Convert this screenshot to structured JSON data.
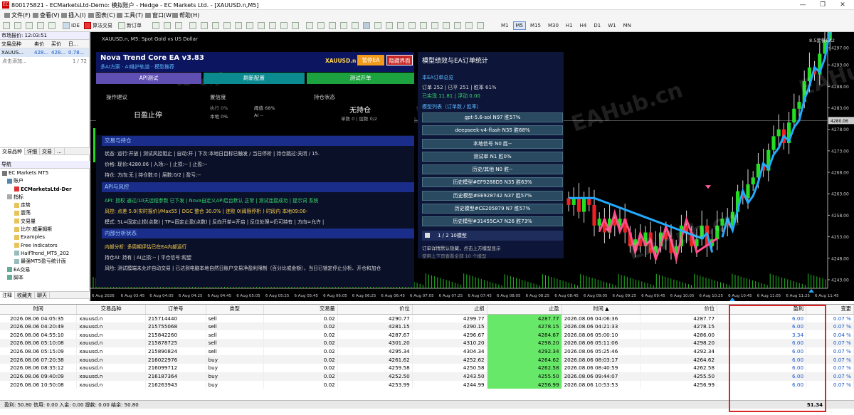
{
  "window": {
    "title": "800175821 - ECMarketsLtd-Demo: 模拟账户 - Hedge - EC Markets Ltd. - [XAUUSD.n,M5]",
    "controls": [
      "—",
      "❐",
      "✕"
    ],
    "icon_text": "EC"
  },
  "menu": [
    "文件(F)",
    "查看(V)",
    "插入(I)",
    "图表(C)",
    "工具(T)",
    "窗口(W)",
    "帮助(H)"
  ],
  "toolbar": {
    "ide": "IDE",
    "algo": "算法交易",
    "new_order": "新订单",
    "timeframes": [
      "M1",
      "M5",
      "M15",
      "M30",
      "H1",
      "H4",
      "D1",
      "W1",
      "MN"
    ],
    "active_tf": "M5"
  },
  "market_watch": {
    "header": "市场报价: 12:03:51",
    "columns": [
      "交易品种",
      "卖价",
      "买价",
      "日..."
    ],
    "rows": [
      {
        "symbol": "XAUUS...",
        "bid": "428...",
        "ask": "428...",
        "change": "0.78..."
      }
    ],
    "add": "点击添加...",
    "count": "1 / 72",
    "tabs": [
      "交易品种",
      "详细",
      "交易",
      "..."
    ]
  },
  "navigator": {
    "header": "导航",
    "items": [
      "EC Markets MT5",
      "账户",
      "ECMarketsLtd-Der",
      "指标",
      "走势",
      "震荡",
      "交易量",
      "比尔·威廉姆斯",
      "Examples",
      "Free Indicators",
      "HalfTrend_MT5_202",
      "最强MT5盈亏统计面",
      "EA交易",
      "脚本"
    ],
    "tabs": [
      "注释",
      "收藏夹",
      "聊天"
    ]
  },
  "chart": {
    "symbol_label": "XAUUSD.n, M5:  Spot Gold vs US Dollar",
    "top_right_label": "8.5套餐EA2",
    "price_ticks": [
      "4297.00",
      "4293.00",
      "4288.00",
      "4283.00",
      "4278.00",
      "4273.00",
      "4268.00",
      "4263.00",
      "4258.00",
      "4253.00",
      "4248.00",
      "4243.00"
    ],
    "current_price": "4280.06",
    "time_ticks": [
      "6 Aug 2026",
      "6 Aug 03:45",
      "6 Aug 04:05",
      "6 Aug 04:25",
      "6 Aug 04:45",
      "6 Aug 05:05",
      "6 Aug 05:25",
      "6 Aug 05:45",
      "6 Aug 06:05",
      "6 Aug 06:25",
      "6 Aug 06:45",
      "6 Aug 07:05",
      "6 Aug 07:25",
      "6 Aug 07:45",
      "6 Aug 08:05",
      "6 Aug 08:25",
      "6 Aug 08:45",
      "6 Aug 09:05",
      "6 Aug 09:25",
      "6 Aug 09:45",
      "6 Aug 10:05",
      "6 Aug 10:25",
      "6 Aug 10:45",
      "6 Aug 11:05",
      "6 Aug 11:25",
      "6 Aug 11:45"
    ],
    "watermark": "EAHub.cn"
  },
  "ea": {
    "title": "Nova Trend Core EA v3.83",
    "subtitle": "多AI方案 · AI维护轨道 · 模型推荐",
    "symbol": "XAUUSD.n  M5",
    "btn_pause": "暂停EA",
    "btn_hide": "隐藏界面",
    "btn_api": "API测试",
    "btn_refresh": "刷新配置",
    "btn_test_open": "测试开单",
    "advice_label": "操作建议",
    "advice_value": "日盈止停",
    "confidence_label": "置信度",
    "conf_exec": "执行 0%",
    "conf_thresh": "阈值 68%",
    "conf_local": "本地 0%",
    "conf_ai": "AI --",
    "position_label": "持仓状态",
    "position_value": "无持仓",
    "position_detail": "单数 0 | 层数 0/2",
    "sec_trade": "交易与持仓",
    "trade_line1": "状态: 运行:开放 | 测试风控阻止 | 自动:开 | 下次:本地日目标已触发 / 当日停析 | 持仓跳过:关闭 / 15.",
    "trade_line2": "价格: 现价:4280.06 | 入场:-- | 止损:-- | 止盈:--",
    "trade_line3": "持仓: 方向:无 | 持仓数:0 | 层数:0/2 | 盈亏:--",
    "sec_api": "API与风控",
    "api_line1": "API: 授权 通过/10天远程参数 已下发 | Nova自定义API后台默认 正常 | 测试连接成功 | 提示词 系统",
    "api_line2": "风控: 点差 5.0(实时报价)/Max55 | DGC 整合 30.0% | 连败 0(阈限停析 ) 时段内 本地09:00-",
    "api_line3": "模式: SL=固定止损(点数) | TP=固定止盈(点数) | 反向开单=开启 | 反位处理=仍可持有 | 方向=允许 |",
    "sec_internal": "内部分析状态",
    "int_line1": "内部分析: 多周期评估已在EA内部运行",
    "int_line2": "持仓AI: 持有 | AI止损:-- | 平仓信号:观望",
    "int_line3": "风险: 测试模端未允许自动交易 | 已达到电脑本地自然日账户交易净盈利限制（百分比或金额），当日已锁定停止分析、开仓和加仓"
  },
  "stats": {
    "title": "模型绩效与EA订单统计",
    "sec_orders": "本EA订单总览",
    "orders_line": "订单 252 | 已平 251 | 胜率 61%",
    "realized": "已实现 11.81 | 浮动 0.00",
    "sec_models": "模型列表（订单数 / 胜率）",
    "models": [
      "gpt-5.6-sol  N97  胜57%",
      "deepseek-v4-flash  N35  胜68%",
      "本地信号  N0  胜--",
      "测试单  N1  胜0%",
      "历史/其他  N0  胜--",
      "历史模型#EF9288D5  N35  胜63%",
      "历史模型#EE928742  N37  胜57%",
      "历史模型#CE205879  N7  胜57%",
      "历史模型#31455CA7  N26  胜73%"
    ],
    "pager": "1 / 2   10模型",
    "hint1": "订单详情默认隐藏，点击上方模型显示",
    "hint2": "使用上下页查看全部 10 个模型"
  },
  "trades": {
    "columns": [
      "时间",
      "交易品种",
      "订单号",
      "类型",
      "交易量",
      "价位",
      "止损",
      "止盈",
      "时间 ▲",
      "价位",
      "盈利",
      "变更"
    ],
    "rows": [
      [
        "2026.08.06 04:05:35",
        "xauusd.n",
        "215714440",
        "sell",
        "0.02",
        "4290.77",
        "4299.77",
        "4287.77",
        "2026.08.06 04:06:36",
        "4287.77",
        "6.00",
        "0.07 %"
      ],
      [
        "2026.08.06 04:20:49",
        "xauusd.n",
        "215755068",
        "sell",
        "0.02",
        "4281.15",
        "4290.15",
        "4278.15",
        "2026.08.06 04:21:33",
        "4278.15",
        "6.00",
        "0.07 %"
      ],
      [
        "2026.08.06 04:55:10",
        "xauusd.n",
        "215842260",
        "sell",
        "0.02",
        "4287.67",
        "4296.67",
        "4284.67",
        "2026.08.06 05:00:10",
        "4286.00",
        "3.34",
        "0.04 %"
      ],
      [
        "2026.08.06 05:10:08",
        "xauusd.n",
        "215878725",
        "sell",
        "0.02",
        "4301.20",
        "4310.20",
        "4298.20",
        "2026.08.06 05:11:06",
        "4298.20",
        "6.00",
        "0.07 %"
      ],
      [
        "2026.08.06 05:15:09",
        "xauusd.n",
        "215890824",
        "sell",
        "0.02",
        "4295.34",
        "4304.34",
        "4292.34",
        "2026.08.06 05:25:46",
        "4292.34",
        "6.00",
        "0.07 %"
      ],
      [
        "2026.08.06 07:20:38",
        "xauusd.n",
        "216022976",
        "buy",
        "0.02",
        "4261.62",
        "4252.62",
        "4264.62",
        "2026.08.06 08:03:17",
        "4264.62",
        "6.00",
        "0.07 %"
      ],
      [
        "2026.08.06 08:35:12",
        "xauusd.n",
        "216099712",
        "buy",
        "0.02",
        "4259.58",
        "4250.58",
        "4262.58",
        "2026.08.06 08:40:59",
        "4262.58",
        "6.00",
        "0.07 %"
      ],
      [
        "2026.08.06 09:40:09",
        "xauusd.n",
        "216187364",
        "buy",
        "0.02",
        "4252.50",
        "4243.50",
        "4255.50",
        "2026.08.06 09:44:07",
        "4255.50",
        "6.00",
        "0.07 %"
      ],
      [
        "2026.08.06 10:50:08",
        "xauusd.n",
        "216263943",
        "buy",
        "0.02",
        "4253.99",
        "4244.99",
        "4256.99",
        "2026.08.06 10:53:53",
        "4256.99",
        "6.00",
        "0.07 %"
      ]
    ],
    "summary": "盈利: 50.80  信用: 0.00  入金: 0.00  提款: 0.00  结余: 50.80",
    "total_profit": "51.34"
  },
  "colors": {
    "ea_panel": "#0b1560",
    "stats_panel": "#0d1638",
    "take_profit": "#68e868",
    "highlight": "#dd2222",
    "bull": "#22dd22",
    "bear": "#ee2222",
    "trend_up": "#22aaff",
    "trend_down": "#ff4d8d"
  }
}
